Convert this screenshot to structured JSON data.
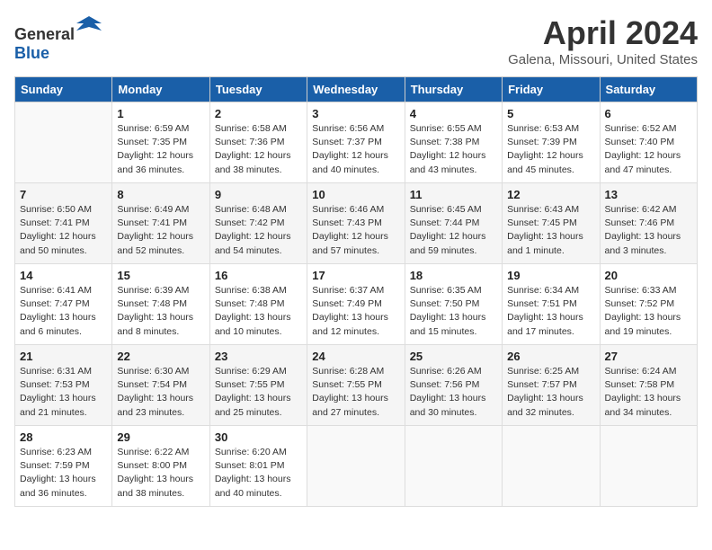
{
  "header": {
    "logo_general": "General",
    "logo_blue": "Blue",
    "month": "April 2024",
    "location": "Galena, Missouri, United States"
  },
  "weekdays": [
    "Sunday",
    "Monday",
    "Tuesday",
    "Wednesday",
    "Thursday",
    "Friday",
    "Saturday"
  ],
  "weeks": [
    [
      {
        "day": "",
        "info": ""
      },
      {
        "day": "1",
        "info": "Sunrise: 6:59 AM\nSunset: 7:35 PM\nDaylight: 12 hours\nand 36 minutes."
      },
      {
        "day": "2",
        "info": "Sunrise: 6:58 AM\nSunset: 7:36 PM\nDaylight: 12 hours\nand 38 minutes."
      },
      {
        "day": "3",
        "info": "Sunrise: 6:56 AM\nSunset: 7:37 PM\nDaylight: 12 hours\nand 40 minutes."
      },
      {
        "day": "4",
        "info": "Sunrise: 6:55 AM\nSunset: 7:38 PM\nDaylight: 12 hours\nand 43 minutes."
      },
      {
        "day": "5",
        "info": "Sunrise: 6:53 AM\nSunset: 7:39 PM\nDaylight: 12 hours\nand 45 minutes."
      },
      {
        "day": "6",
        "info": "Sunrise: 6:52 AM\nSunset: 7:40 PM\nDaylight: 12 hours\nand 47 minutes."
      }
    ],
    [
      {
        "day": "7",
        "info": "Sunrise: 6:50 AM\nSunset: 7:41 PM\nDaylight: 12 hours\nand 50 minutes."
      },
      {
        "day": "8",
        "info": "Sunrise: 6:49 AM\nSunset: 7:41 PM\nDaylight: 12 hours\nand 52 minutes."
      },
      {
        "day": "9",
        "info": "Sunrise: 6:48 AM\nSunset: 7:42 PM\nDaylight: 12 hours\nand 54 minutes."
      },
      {
        "day": "10",
        "info": "Sunrise: 6:46 AM\nSunset: 7:43 PM\nDaylight: 12 hours\nand 57 minutes."
      },
      {
        "day": "11",
        "info": "Sunrise: 6:45 AM\nSunset: 7:44 PM\nDaylight: 12 hours\nand 59 minutes."
      },
      {
        "day": "12",
        "info": "Sunrise: 6:43 AM\nSunset: 7:45 PM\nDaylight: 13 hours\nand 1 minute."
      },
      {
        "day": "13",
        "info": "Sunrise: 6:42 AM\nSunset: 7:46 PM\nDaylight: 13 hours\nand 3 minutes."
      }
    ],
    [
      {
        "day": "14",
        "info": "Sunrise: 6:41 AM\nSunset: 7:47 PM\nDaylight: 13 hours\nand 6 minutes."
      },
      {
        "day": "15",
        "info": "Sunrise: 6:39 AM\nSunset: 7:48 PM\nDaylight: 13 hours\nand 8 minutes."
      },
      {
        "day": "16",
        "info": "Sunrise: 6:38 AM\nSunset: 7:48 PM\nDaylight: 13 hours\nand 10 minutes."
      },
      {
        "day": "17",
        "info": "Sunrise: 6:37 AM\nSunset: 7:49 PM\nDaylight: 13 hours\nand 12 minutes."
      },
      {
        "day": "18",
        "info": "Sunrise: 6:35 AM\nSunset: 7:50 PM\nDaylight: 13 hours\nand 15 minutes."
      },
      {
        "day": "19",
        "info": "Sunrise: 6:34 AM\nSunset: 7:51 PM\nDaylight: 13 hours\nand 17 minutes."
      },
      {
        "day": "20",
        "info": "Sunrise: 6:33 AM\nSunset: 7:52 PM\nDaylight: 13 hours\nand 19 minutes."
      }
    ],
    [
      {
        "day": "21",
        "info": "Sunrise: 6:31 AM\nSunset: 7:53 PM\nDaylight: 13 hours\nand 21 minutes."
      },
      {
        "day": "22",
        "info": "Sunrise: 6:30 AM\nSunset: 7:54 PM\nDaylight: 13 hours\nand 23 minutes."
      },
      {
        "day": "23",
        "info": "Sunrise: 6:29 AM\nSunset: 7:55 PM\nDaylight: 13 hours\nand 25 minutes."
      },
      {
        "day": "24",
        "info": "Sunrise: 6:28 AM\nSunset: 7:55 PM\nDaylight: 13 hours\nand 27 minutes."
      },
      {
        "day": "25",
        "info": "Sunrise: 6:26 AM\nSunset: 7:56 PM\nDaylight: 13 hours\nand 30 minutes."
      },
      {
        "day": "26",
        "info": "Sunrise: 6:25 AM\nSunset: 7:57 PM\nDaylight: 13 hours\nand 32 minutes."
      },
      {
        "day": "27",
        "info": "Sunrise: 6:24 AM\nSunset: 7:58 PM\nDaylight: 13 hours\nand 34 minutes."
      }
    ],
    [
      {
        "day": "28",
        "info": "Sunrise: 6:23 AM\nSunset: 7:59 PM\nDaylight: 13 hours\nand 36 minutes."
      },
      {
        "day": "29",
        "info": "Sunrise: 6:22 AM\nSunset: 8:00 PM\nDaylight: 13 hours\nand 38 minutes."
      },
      {
        "day": "30",
        "info": "Sunrise: 6:20 AM\nSunset: 8:01 PM\nDaylight: 13 hours\nand 40 minutes."
      },
      {
        "day": "",
        "info": ""
      },
      {
        "day": "",
        "info": ""
      },
      {
        "day": "",
        "info": ""
      },
      {
        "day": "",
        "info": ""
      }
    ]
  ]
}
